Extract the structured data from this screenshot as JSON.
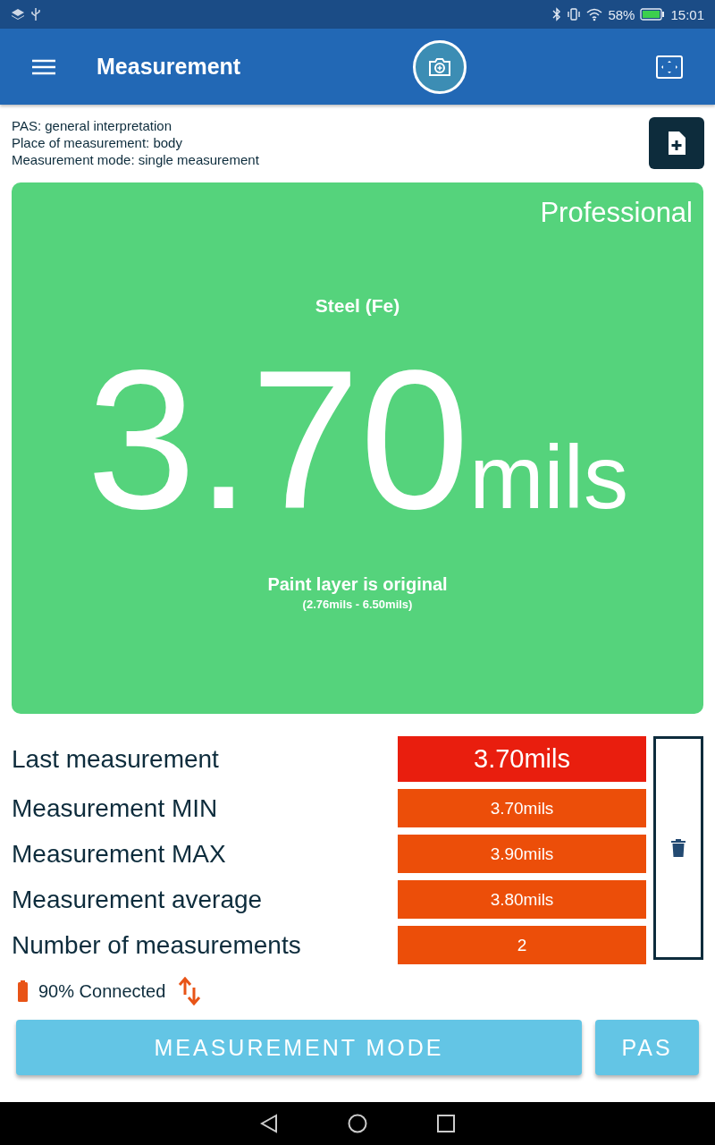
{
  "status_bar": {
    "battery": "58%",
    "time": "15:01"
  },
  "app_bar": {
    "title": "Measurement"
  },
  "info_lines": [
    "PAS: general interpretation",
    "Place of measurement: body",
    "Measurement mode: single measurement"
  ],
  "result_card": {
    "badge": "Professional",
    "material": "Steel (Fe)",
    "value": "3.70",
    "unit": "mils",
    "verdict": "Paint layer is original",
    "range": "(2.76mils - 6.50mils)"
  },
  "stats": [
    {
      "kind": "latest",
      "label": "Last measurement",
      "value": "3.70mils"
    },
    {
      "kind": "summary",
      "label": "Measurement MIN",
      "value": "3.70mils"
    },
    {
      "kind": "summary",
      "label": "Measurement MAX",
      "value": "3.90mils"
    },
    {
      "kind": "summary",
      "label": "Measurement average",
      "value": "3.80mils"
    },
    {
      "kind": "summary",
      "label": "Number of measurements",
      "value": "2"
    }
  ],
  "device_status": {
    "text": "90% Connected"
  },
  "buttons": [
    "MEASUREMENT MODE",
    "PAS"
  ]
}
